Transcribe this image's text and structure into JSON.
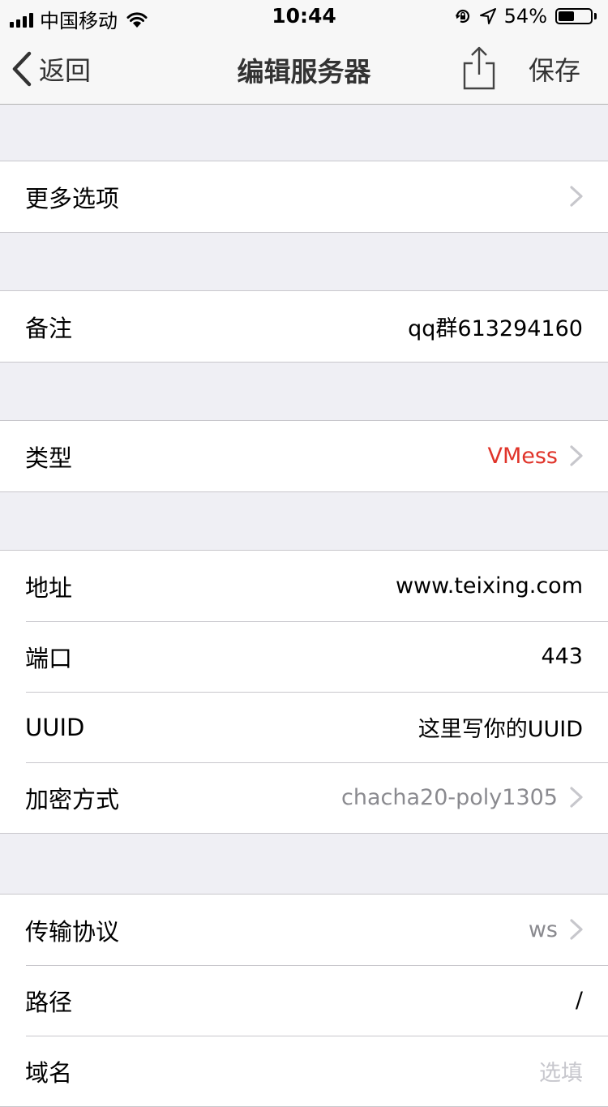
{
  "status_bar": {
    "carrier": "中国移动",
    "time": "10:44",
    "battery": "54%",
    "battery_level": 0.54
  },
  "nav": {
    "back_label": "返回",
    "title": "编辑服务器",
    "save_label": "保存",
    "share_icon": "share-icon"
  },
  "sections": [
    {
      "rows": [
        {
          "label": "更多选项",
          "value": "",
          "chevron": true
        }
      ]
    },
    {
      "rows": [
        {
          "label": "备注",
          "value": "qq群613294160"
        }
      ]
    },
    {
      "rows": [
        {
          "label": "类型",
          "value": "VMess",
          "chevron": true,
          "value_color": "#e0342a"
        }
      ]
    },
    {
      "rows": [
        {
          "label": "地址",
          "value": "www.teixing.com"
        },
        {
          "label": "端口",
          "value": "443"
        },
        {
          "label": "UUID",
          "value": "这里写你的UUID"
        },
        {
          "label": "加密方式",
          "value": "chacha20-poly1305",
          "chevron": true
        }
      ]
    },
    {
      "rows": [
        {
          "label": "传输协议",
          "value": "ws",
          "chevron": true
        },
        {
          "label": "路径",
          "value": "/"
        },
        {
          "label": "域名",
          "placeholder": "选填"
        }
      ]
    }
  ],
  "colors": {
    "background": "#efeff4",
    "accent_red": "#e0342a",
    "separator": "#c8c7cc",
    "secondary_text": "#8a8a8f"
  }
}
